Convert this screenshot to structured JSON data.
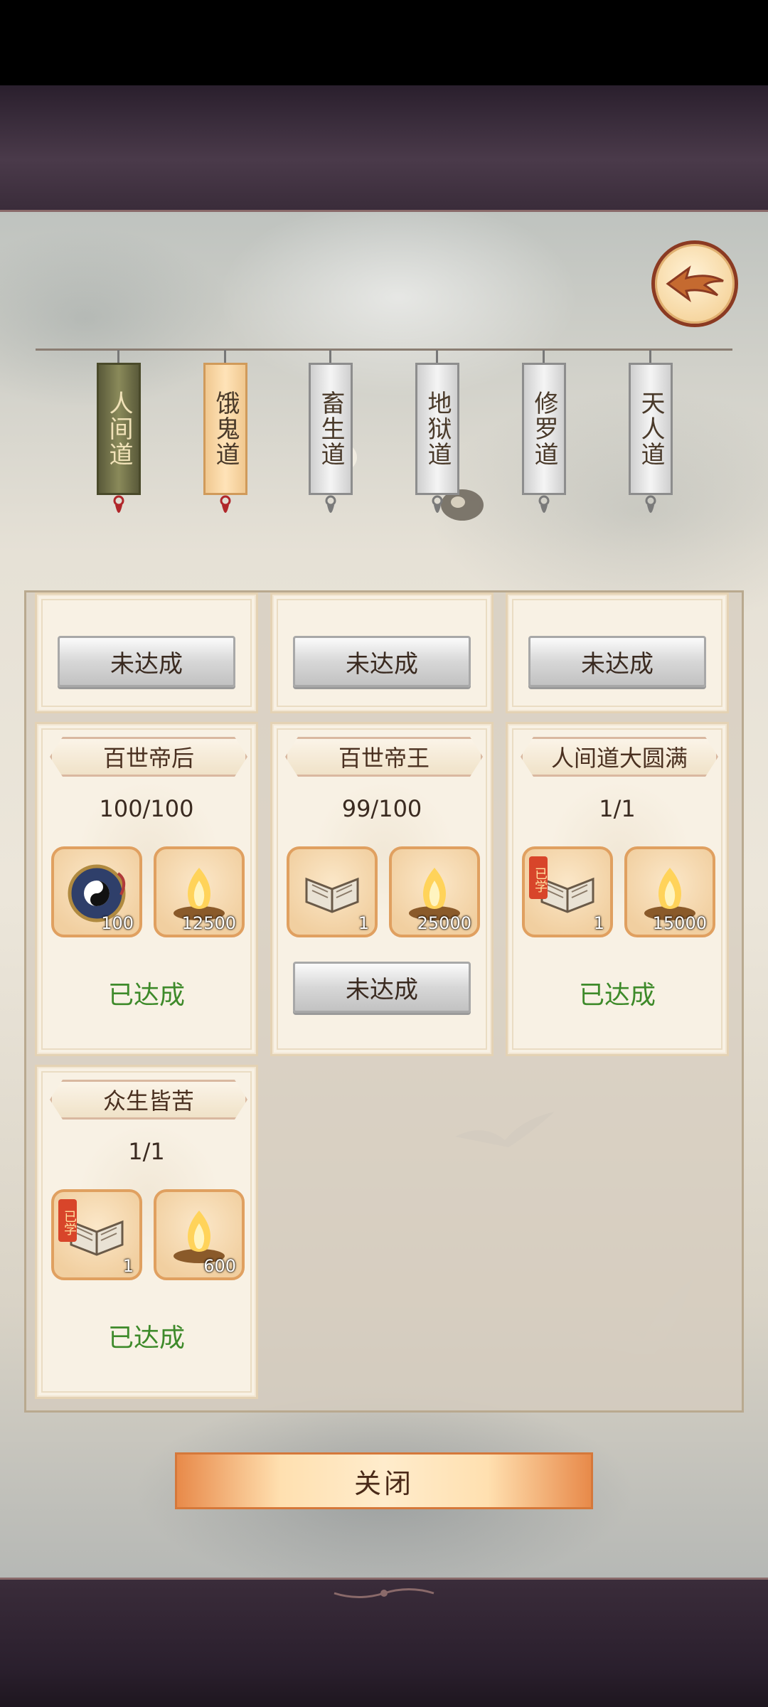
{
  "tabs": [
    {
      "label": "人间道",
      "state": "active"
    },
    {
      "label": "饿鬼道",
      "state": "hover"
    },
    {
      "label": "畜生道",
      "state": "normal"
    },
    {
      "label": "地狱道",
      "state": "normal"
    },
    {
      "label": "修罗道",
      "state": "normal"
    },
    {
      "label": "天人道",
      "state": "normal"
    }
  ],
  "top_row": [
    {
      "status": "未达成"
    },
    {
      "status": "未达成"
    },
    {
      "status": "未达成"
    }
  ],
  "achievements": [
    {
      "title": "百世帝后",
      "progress": "100/100",
      "rewards": [
        {
          "icon": "bagua-mirror-icon",
          "count": "100",
          "learned": false
        },
        {
          "icon": "spirit-flame-icon",
          "count": "12500",
          "learned": false
        }
      ],
      "status": "已达成",
      "completed": true
    },
    {
      "title": "百世帝王",
      "progress": "99/100",
      "rewards": [
        {
          "icon": "scroll-book-icon",
          "count": "1",
          "learned": false
        },
        {
          "icon": "spirit-flame-icon",
          "count": "25000",
          "learned": false
        }
      ],
      "status": "未达成",
      "completed": false
    },
    {
      "title": "人间道大圆满",
      "progress": "1/1",
      "rewards": [
        {
          "icon": "scroll-book-icon",
          "count": "1",
          "learned": true
        },
        {
          "icon": "spirit-flame-icon",
          "count": "15000",
          "learned": false
        }
      ],
      "status": "已达成",
      "completed": true
    },
    {
      "title": "众生皆苦",
      "progress": "1/1",
      "rewards": [
        {
          "icon": "scroll-book-icon",
          "count": "1",
          "learned": true
        },
        {
          "icon": "spirit-flame-icon",
          "count": "600",
          "learned": false
        }
      ],
      "status": "已达成",
      "completed": true
    }
  ],
  "learned_tag": "已学",
  "close_label": "关闭",
  "colors": {
    "done": "#3e8a2a",
    "accent": "#e88a4a",
    "frame": "#8b3a22"
  }
}
